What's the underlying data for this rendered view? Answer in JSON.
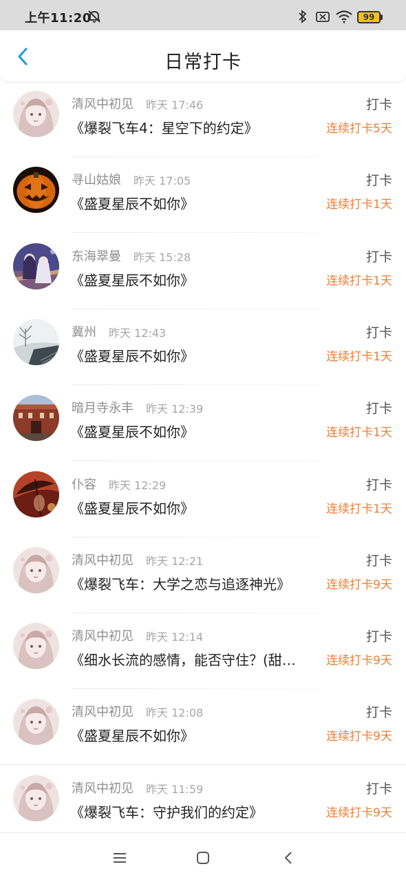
{
  "status_bar": {
    "time": "上午11:20",
    "battery": "99",
    "icons": [
      "bell-off-icon",
      "bluetooth-icon",
      "no-sim-icon",
      "wifi-icon",
      "battery-icon"
    ]
  },
  "header": {
    "title": "日常打卡",
    "back_icon": "chevron-left-icon"
  },
  "items": [
    {
      "user": "清风中初见",
      "time": "昨天 17:46",
      "action": "打卡",
      "book": "《爆裂飞车4：星空下的约定》",
      "streak": "连续打卡5天",
      "avatar": "anime-girl"
    },
    {
      "user": "寻山姑娘",
      "time": "昨天 17:05",
      "action": "打卡",
      "book": "《盛夏星辰不如你》",
      "streak": "连续打卡1天",
      "avatar": "pumpkin"
    },
    {
      "user": "东海翠曼",
      "time": "昨天 15:28",
      "action": "打卡",
      "book": "《盛夏星辰不如你》",
      "streak": "连续打卡1天",
      "avatar": "couple"
    },
    {
      "user": "冀州",
      "time": "昨天 12:43",
      "action": "打卡",
      "book": "《盛夏星辰不如你》",
      "streak": "连续打卡1天",
      "avatar": "winter"
    },
    {
      "user": "暗月寺永丰",
      "time": "昨天 12:39",
      "action": "打卡",
      "book": "《盛夏星辰不如你》",
      "streak": "连续打卡1天",
      "avatar": "building"
    },
    {
      "user": "仆容",
      "time": "昨天 12:29",
      "action": "打卡",
      "book": "《盛夏星辰不如你》",
      "streak": "连续打卡1天",
      "avatar": "umbrella"
    },
    {
      "user": "清风中初见",
      "time": "昨天 12:21",
      "action": "打卡",
      "book": "《爆裂飞车：大学之恋与追逐神光》",
      "streak": "连续打卡9天",
      "avatar": "anime-girl"
    },
    {
      "user": "清风中初见",
      "time": "昨天 12:14",
      "action": "打卡",
      "book": "《细水长流的感情，能否守住？(甜…",
      "streak": "连续打卡9天",
      "avatar": "anime-girl"
    },
    {
      "user": "清风中初见",
      "time": "昨天 12:08",
      "action": "打卡",
      "book": "《盛夏星辰不如你》",
      "streak": "连续打卡9天",
      "avatar": "anime-girl"
    },
    {
      "user": "清风中初见",
      "time": "昨天 11:59",
      "action": "打卡",
      "book": "《爆裂飞车：守护我们的约定》",
      "streak": "连续打卡9天",
      "avatar": "anime-girl"
    }
  ],
  "nav_bar": {
    "buttons": [
      "menu-icon",
      "home-square-icon",
      "back-triangle-icon"
    ]
  },
  "colors": {
    "accent": "#2196e8",
    "streak": "#ef7d33",
    "status_bar_bg": "#dcdcdc",
    "battery": "#f3c11a"
  }
}
